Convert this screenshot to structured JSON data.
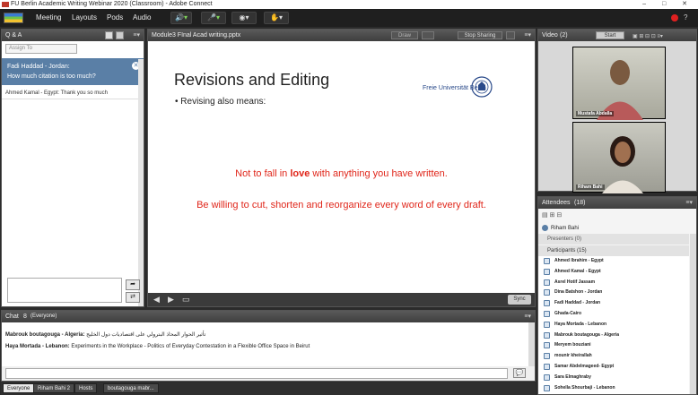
{
  "window": {
    "title": "FU Berlin Academic Writing Webinar 2020 (Classroom) - Adobe Connect",
    "controls": "– □ ✕"
  },
  "menubar": {
    "items": [
      "Meeting",
      "Layouts",
      "Pods",
      "Audio"
    ]
  },
  "qa": {
    "title": "Q & A",
    "filter_placeholder": "Assign To",
    "selected": {
      "author": "Fadi Haddad - Jordan:",
      "text": "How much citation is too much?"
    },
    "items": [
      {
        "text": "Ahmed Kamal - Egypt: Thank you so much"
      }
    ]
  },
  "share": {
    "title": "Module3 FInal Acad writing.pptx",
    "buttons": {
      "draw": "Draw",
      "stop": "Stop Sharing"
    },
    "slide": {
      "title": "Revisions and Editing",
      "bullet": "Revising also means:",
      "line1_pre": "Not to fall in ",
      "line1_bold": "love",
      "line1_post": " with anything you have written.",
      "line2": "Be willing to cut, shorten and reorganize every word of every draft.",
      "logo_text": "Freie Universität Berlin"
    },
    "sync_label": "Sync"
  },
  "video": {
    "title": "Video",
    "count": "(2)",
    "start_label": "Start",
    "tiles": [
      {
        "name": "Mustafa Abdalla"
      },
      {
        "name": "Riham Bahi"
      }
    ]
  },
  "attendees": {
    "title": "Attendees",
    "count": "(18)",
    "host": "Riham Bahi",
    "presenters_label": "Presenters (0)",
    "participants_label": "Participants (15)",
    "participants": [
      "Ahmed Ibrahim - Egypt",
      "Ahmed Kamal - Egypt",
      "Asrel Hotif Jassam",
      "Dina Batshon - Jordan",
      "Fadi Haddad - Jordan",
      "Ghada-Cairo",
      "Haya Mortada - Lebanon",
      "Mabrouk boutagouga - Algeria",
      "Meryem bouziani",
      "mounir kheirallah",
      "Samar Abdelmageed- Egypt",
      "Sara Elmaghraby",
      "Sohella Shourbaji - Lebanon"
    ]
  },
  "chat": {
    "title": "Chat",
    "count": "8",
    "scope": "(Everyone)",
    "messages": [
      {
        "author": "Mabrouk boutagouga - Algeria:",
        "text": "تأثير الحوار المحاذ البترولي على اقتصاديات دول الخليج"
      },
      {
        "author": "Haya Mortada - Lebanon:",
        "text": "Experiments in the Workplace - Politics of Everyday Contestation in a Flexible Office Space in Beirut"
      }
    ],
    "tabs": [
      "Everyone",
      "Riham Bahi 2",
      "Hosts",
      "boutagouga mabr..."
    ]
  }
}
